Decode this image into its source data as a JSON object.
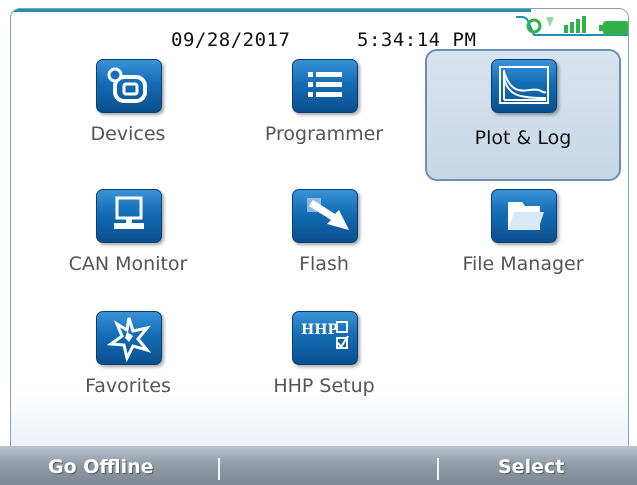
{
  "status": {
    "date": "09/28/2017",
    "time": "5:34:14 PM",
    "signal_icon": "signal-icon",
    "battery_icon": "battery-icon"
  },
  "apps": [
    {
      "label": "Devices",
      "icon": "devices-icon",
      "selected": false
    },
    {
      "label": "Programmer",
      "icon": "list-icon",
      "selected": false
    },
    {
      "label": "Plot & Log",
      "icon": "chart-icon",
      "selected": true
    },
    {
      "label": "CAN Monitor",
      "icon": "monitor-icon",
      "selected": false
    },
    {
      "label": "Flash",
      "icon": "flash-arrow-icon",
      "selected": false
    },
    {
      "label": "File Manager",
      "icon": "folder-icon",
      "selected": false
    },
    {
      "label": "Favorites",
      "icon": "star-icon",
      "selected": false
    },
    {
      "label": "HHP Setup",
      "icon": "hhp-setup-icon",
      "selected": false
    }
  ],
  "softkeys": {
    "left": "Go Offline",
    "right": "Select"
  },
  "colors": {
    "tile_blue": "#136cb5",
    "selected_bg": "#c7d7e6",
    "softbar": "#8f9aa6",
    "accent_green": "#2fb24a"
  }
}
